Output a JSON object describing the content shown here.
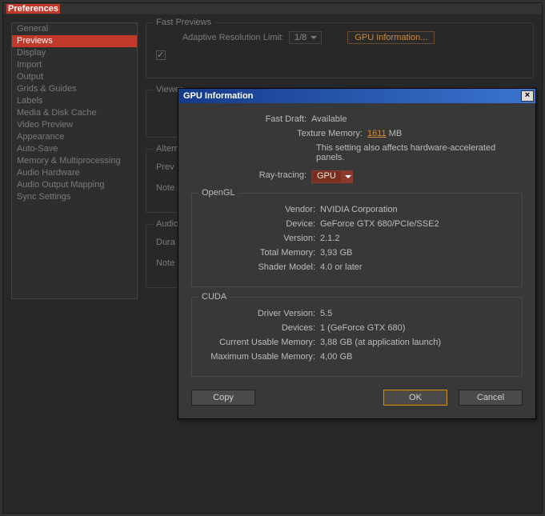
{
  "prefs": {
    "title": "Preferences",
    "sidebar": [
      "General",
      "Previews",
      "Display",
      "Import",
      "Output",
      "Grids & Guides",
      "Labels",
      "Media & Disk Cache",
      "Video Preview",
      "Appearance",
      "Auto-Save",
      "Memory & Multiprocessing",
      "Audio Hardware",
      "Audio Output Mapping",
      "Sync Settings"
    ],
    "selected_index": 1,
    "fast_previews": {
      "title": "Fast Previews",
      "adaptive_label": "Adaptive Resolution Limit:",
      "adaptive_value": "1/8",
      "gpu_info_btn": "GPU Information..."
    },
    "viewer": {
      "title": "Viewer"
    },
    "altern": {
      "title": "Altern",
      "prev": "Prev",
      "note": "Note"
    },
    "audio": {
      "title": "Audio",
      "dura": "Dura",
      "note": "Note"
    }
  },
  "gpu": {
    "title": "GPU Information",
    "fast_draft_label": "Fast Draft:",
    "fast_draft_value": "Available",
    "texture_memory_label": "Texture Memory:",
    "texture_memory_value": "1611",
    "texture_memory_unit": "MB",
    "texture_note": "This setting also affects hardware-accelerated panels.",
    "ray_tracing_label": "Ray-tracing:",
    "ray_tracing_value": "GPU",
    "opengl": {
      "title": "OpenGL",
      "vendor_label": "Vendor:",
      "vendor": "NVIDIA Corporation",
      "device_label": "Device:",
      "device": "GeForce GTX 680/PCIe/SSE2",
      "version_label": "Version:",
      "version": "2.1.2",
      "total_memory_label": "Total Memory:",
      "total_memory": "3,93 GB",
      "shader_model_label": "Shader Model:",
      "shader_model": "4.0 or later"
    },
    "cuda": {
      "title": "CUDA",
      "driver_version_label": "Driver Version:",
      "driver_version": "5.5",
      "devices_label": "Devices:",
      "devices": "1 (GeForce GTX 680)",
      "current_usable_label": "Current Usable Memory:",
      "current_usable": "3,88 GB (at application launch)",
      "max_usable_label": "Maximum Usable Memory:",
      "max_usable": "4,00 GB"
    },
    "buttons": {
      "copy": "Copy",
      "ok": "OK",
      "cancel": "Cancel"
    }
  }
}
